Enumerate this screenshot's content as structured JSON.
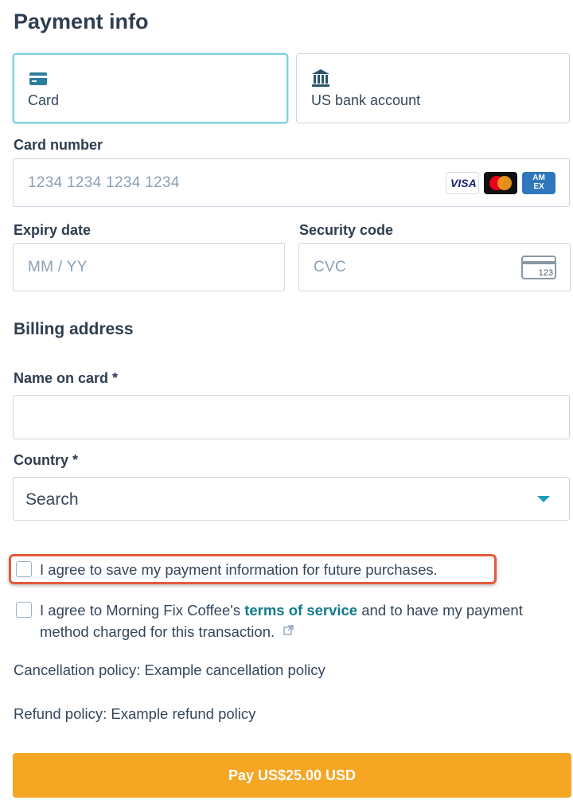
{
  "page": {
    "title": "Payment info"
  },
  "payment_methods": {
    "card_label": "Card",
    "bank_label": "US bank account",
    "selected": "Card"
  },
  "card_number": {
    "label": "Card number",
    "placeholder": "1234 1234 1234 1234",
    "brands": [
      "VISA",
      "Mastercard",
      "AMEX"
    ],
    "visa_text": "VISA",
    "amex_text": "AM EX"
  },
  "expiry": {
    "label": "Expiry date",
    "placeholder": "MM / YY"
  },
  "security_code": {
    "label": "Security code",
    "placeholder": "CVC",
    "icon_text": "123"
  },
  "billing": {
    "heading": "Billing address",
    "name_label": "Name on card *",
    "name_value": "",
    "country_label": "Country *",
    "country_value": "Search"
  },
  "consents": {
    "save_info": {
      "text": "I agree to save my payment information for future purchases.",
      "checked": false
    },
    "terms": {
      "text_before": "I agree to Morning Fix Coffee's ",
      "link_text": "terms of service",
      "text_after": " and to have my payment method charged for this transaction.",
      "checked": false
    }
  },
  "policies": {
    "cancellation": "Cancellation policy: Example cancellation policy",
    "refund": "Refund policy: Example refund policy"
  },
  "pay_button": {
    "label": "Pay US$25.00 USD"
  },
  "colors": {
    "accent": "#f5a623",
    "selected_border": "#7fd1de",
    "link": "#127a8a",
    "highlight_border": "#e35b3c",
    "caret": "#1f9dbc"
  }
}
